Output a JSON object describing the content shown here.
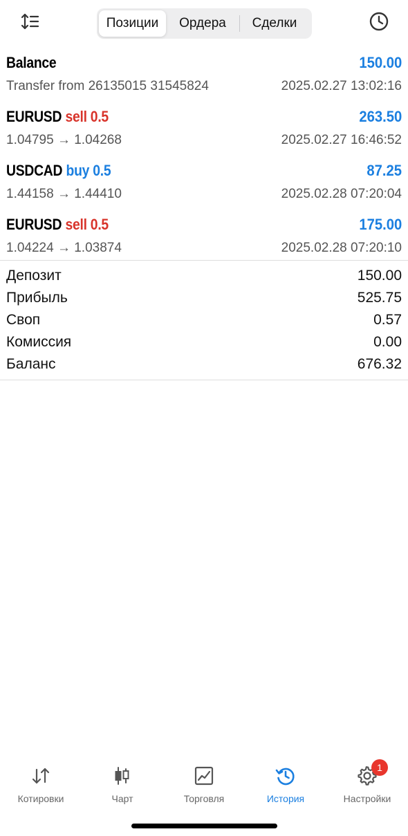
{
  "header": {
    "sort_icon": "sort-arrows-icon",
    "history_icon": "clock-icon",
    "tabs": [
      {
        "label": "Позиции",
        "active": true
      },
      {
        "label": "Ордера",
        "active": false
      },
      {
        "label": "Сделки",
        "active": false
      }
    ]
  },
  "deals": [
    {
      "symbol": "Balance",
      "side": "",
      "volume": "",
      "amount": "150.00",
      "subtitle": "Transfer from 26135015 31545824",
      "time": "2025.02.27 13:02:16"
    },
    {
      "symbol": "EURUSD",
      "side": "sell",
      "volume": "0.5",
      "amount": "263.50",
      "subtitle": "1.04795 → 1.04268",
      "time": "2025.02.27 16:46:52"
    },
    {
      "symbol": "USDCAD",
      "side": "buy",
      "volume": "0.5",
      "amount": "87.25",
      "subtitle": "1.44158 → 1.44410",
      "time": "2025.02.28 07:20:04"
    },
    {
      "symbol": "EURUSD",
      "side": "sell",
      "volume": "0.5",
      "amount": "175.00",
      "subtitle": "1.04224 → 1.03874",
      "time": "2025.02.28 07:20:10"
    }
  ],
  "summary": [
    {
      "label": "Депозит",
      "value": "150.00"
    },
    {
      "label": "Прибыль",
      "value": "525.75"
    },
    {
      "label": "Своп",
      "value": "0.57"
    },
    {
      "label": "Комиссия",
      "value": "0.00"
    },
    {
      "label": "Баланс",
      "value": "676.32"
    }
  ],
  "tabbar": {
    "items": [
      {
        "label": "Котировки",
        "icon": "quotes-arrows-icon"
      },
      {
        "label": "Чарт",
        "icon": "candlestick-chart-icon"
      },
      {
        "label": "Торговля",
        "icon": "trade-chart-icon"
      },
      {
        "label": "История",
        "icon": "history-icon",
        "active": true
      },
      {
        "label": "Настройки",
        "icon": "gear-icon",
        "badge": "1"
      }
    ]
  },
  "colors": {
    "accent": "#1b7fe0",
    "sell": "#d8342b",
    "buy": "#1b7fe0",
    "badge": "#e8362d",
    "muted": "#555555"
  }
}
